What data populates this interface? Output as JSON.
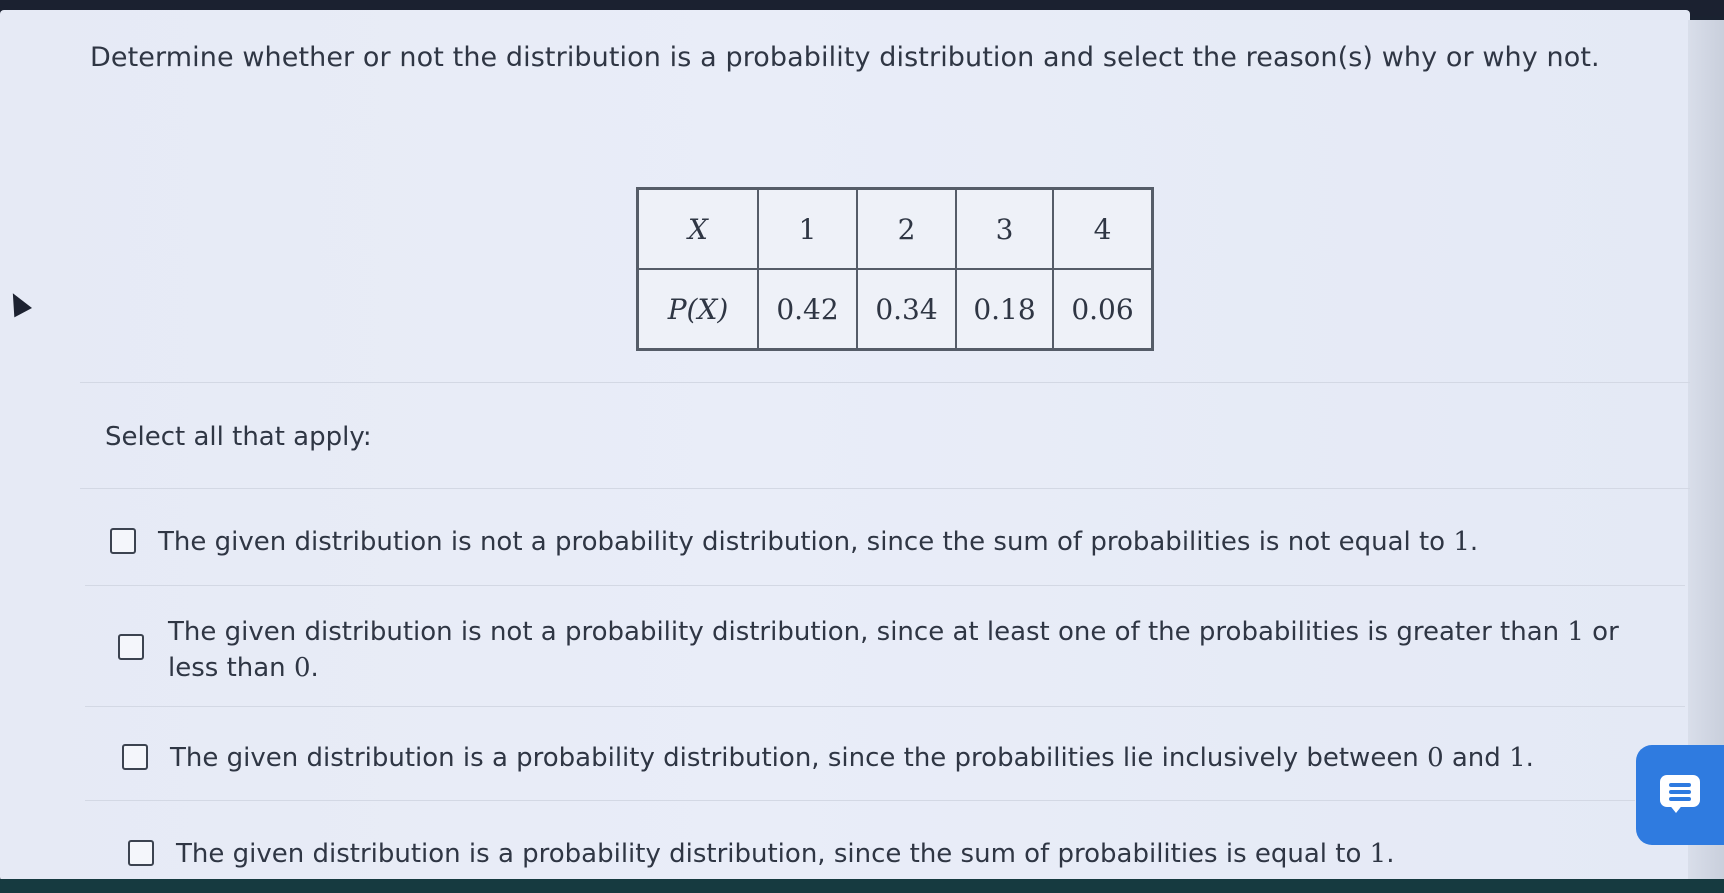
{
  "question": {
    "text": "Determine whether or not the distribution is a probability distribution and select the reason(s) why or why not."
  },
  "distribution_table": {
    "row_x_label": "X",
    "row_p_label": "P(X)",
    "x_values": [
      "1",
      "2",
      "3",
      "4"
    ],
    "p_values": [
      "0.42",
      "0.34",
      "0.18",
      "0.06"
    ]
  },
  "answers": {
    "select_label": "Select all that apply:",
    "options": [
      {
        "pre": "The given distribution is not a probability distribution, since the sum of probabilities is not equal to ",
        "n1": "1",
        "post": ".",
        "checked": false
      },
      {
        "pre": "The given distribution is not a probability distribution, since at least one of the probabilities is greater than ",
        "n1": "1",
        "mid": " or",
        "line2_pre": "less than ",
        "n2": "0",
        "post": ".",
        "checked": false
      },
      {
        "pre": "The given distribution is a probability distribution, since the probabilities lie inclusively between ",
        "n1": "0",
        "mid": " and ",
        "n2": "1",
        "post": ".",
        "checked": false
      },
      {
        "pre": "The given distribution is a probability distribution, since the sum of probabilities is equal to ",
        "n1": "1",
        "post": ".",
        "checked": false
      }
    ]
  },
  "icons": {
    "chat": "chat-icon",
    "cursor": "cursor-arrow-icon",
    "checkbox": "checkbox-icon"
  },
  "colors": {
    "accent": "#2f7be0",
    "background": "#e8ecf7",
    "text": "#2f3644"
  }
}
